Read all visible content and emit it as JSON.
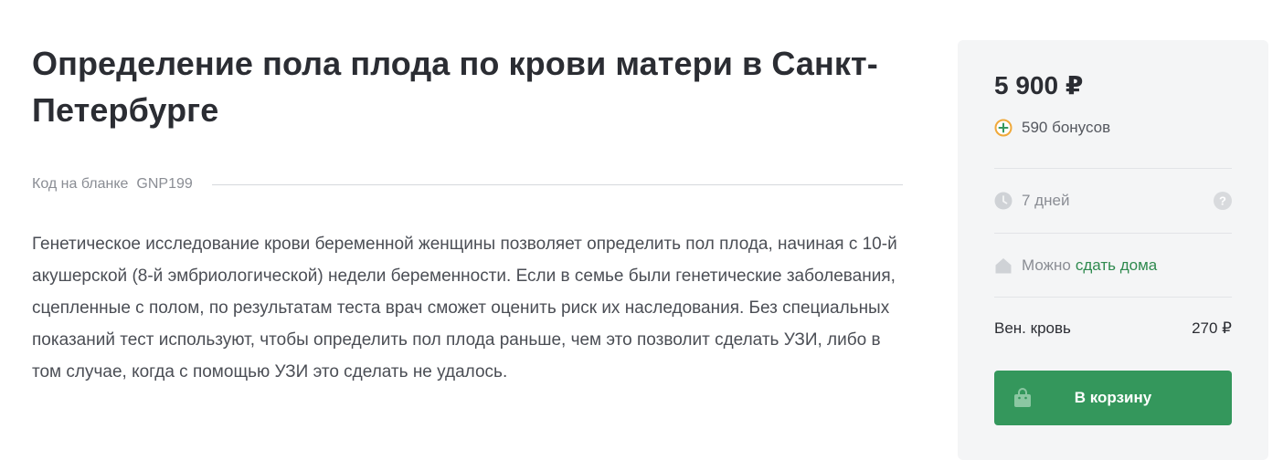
{
  "product": {
    "title": "Определение пола плода по крови матери в Санкт-Петербурге",
    "code_label": "Код на бланке",
    "code_value": "GNP199",
    "description": "Генетическое исследование крови беременной женщины позволяет определить пол плода, начиная с 10-й акушерской (8-й эмбриологической) недели беременности. Если в семье были генетические заболевания, сцепленные с полом, по результатам теста врач сможет оценить риск их наследования. Без специальных показаний тест используют, чтобы определить пол плода раньше, чем это позволит сделать УЗИ, либо в том случае, когда с помощью УЗИ это сделать не удалось."
  },
  "card": {
    "price": "5 900 ₽",
    "bonus_text": "590 бонусов",
    "days_text": "7 дней",
    "home_prefix": "Можно",
    "home_link": "сдать дома",
    "blood_label": "Вен. кровь",
    "blood_price": "270 ₽",
    "cart_label": "В корзину",
    "icons": {
      "bonus": "plus-circle-icon",
      "days": "clock-icon",
      "help": "question-icon",
      "home": "house-icon",
      "cart": "bag-icon"
    },
    "colors": {
      "accent": "#34975c",
      "link": "#2f8a4f",
      "bonus_ring": "#f0a93a",
      "card_bg": "#f4f5f6"
    }
  }
}
